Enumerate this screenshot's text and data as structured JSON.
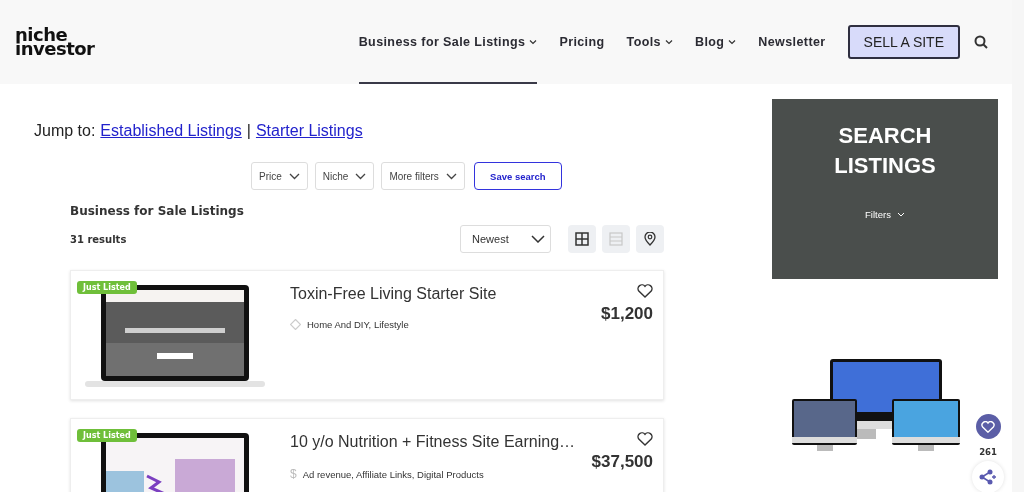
{
  "logo": {
    "line1": "niche",
    "line2": "investor"
  },
  "nav": {
    "items": [
      {
        "label": "Business for Sale Listings",
        "dropdown": true,
        "selected": true
      },
      {
        "label": "Pricing",
        "dropdown": false,
        "selected": false
      },
      {
        "label": "Tools",
        "dropdown": true,
        "selected": false
      },
      {
        "label": "Blog",
        "dropdown": true,
        "selected": false
      },
      {
        "label": "Newsletter",
        "dropdown": false,
        "selected": false
      }
    ],
    "cta": "SELL A SITE"
  },
  "jump_to": {
    "label": "Jump to:",
    "links": [
      "Established Listings",
      "Starter Listings"
    ],
    "separator": "|"
  },
  "filters": [
    {
      "label": "Price"
    },
    {
      "label": "Niche"
    },
    {
      "label": "More filters"
    }
  ],
  "save_search": "Save search",
  "listings": {
    "title": "Business for Sale Listings",
    "count": "31 results",
    "sort": "Newest",
    "views": [
      {
        "kind": "grid",
        "disabled": false
      },
      {
        "kind": "list",
        "disabled": true
      },
      {
        "kind": "map",
        "disabled": false
      }
    ],
    "items": [
      {
        "badge": "Just Listed",
        "title": "Toxin-Free Living Starter Site",
        "kind": "niche",
        "meta": "Home And DIY, Lifestyle",
        "price": "$1,200"
      },
      {
        "badge": "Just Listed",
        "title": "10 y/o Nutrition + Fitness Site Earning…",
        "kind": "revenue",
        "meta_icon": "$",
        "meta": "Ad revenue, Affiliate Links, Digital Products",
        "price": "$37,500"
      }
    ]
  },
  "sidebar": {
    "title": "SEARCH LISTINGS",
    "filters": "Filters"
  },
  "share": {
    "count": "261"
  }
}
